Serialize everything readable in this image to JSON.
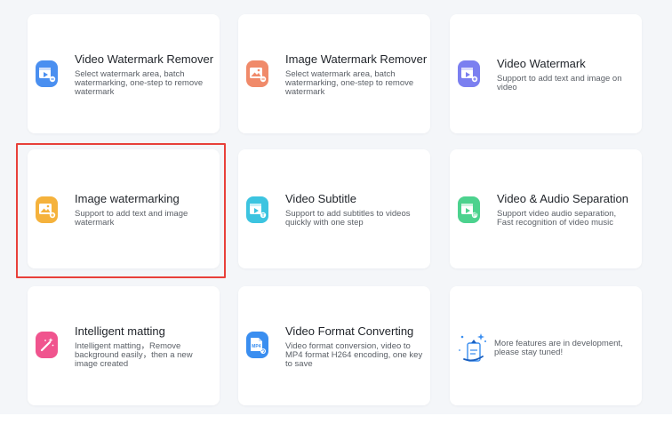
{
  "features": [
    {
      "title": "Video Watermark Remover",
      "desc": "Select watermark area, batch watermarking, one-step to remove watermark",
      "icon": "video-watermark-remover-icon",
      "color": "#4a8ff0"
    },
    {
      "title": "Image Watermark Remover",
      "desc": "Select watermark area, batch watermarking, one-step to remove watermark",
      "icon": "image-watermark-remover-icon",
      "color": "#f08a6a"
    },
    {
      "title": "Video Watermark",
      "desc": "Support to add text and image on video",
      "icon": "video-watermark-icon",
      "color": "#7b7ff0"
    },
    {
      "title": "Image watermarking",
      "desc": "Support to add text and image watermark",
      "icon": "image-watermarking-icon",
      "color": "#f5b23c"
    },
    {
      "title": "Video Subtitle",
      "desc": "Support to add subtitles to videos quickly with one step",
      "icon": "video-subtitle-icon",
      "color": "#3cc4e0"
    },
    {
      "title": "Video & Audio Separation",
      "desc": "Support video audio separation, Fast recognition of video music",
      "icon": "video-audio-separation-icon",
      "color": "#4cd28e"
    },
    {
      "title": "Intelligent matting",
      "desc": "Intelligent matting，Remove background easily，then a new image created",
      "icon": "intelligent-matting-icon",
      "color": "#f0548e"
    },
    {
      "title": "Video Format Converting",
      "desc": "Video format conversion, video to MP4 format H264 encoding, one key to save",
      "icon": "video-format-converting-icon",
      "color": "#3a8ef0",
      "badge": "MP4"
    }
  ],
  "more": {
    "text": "More features are in development, please stay tuned!",
    "icon": "under-development-illustration"
  }
}
